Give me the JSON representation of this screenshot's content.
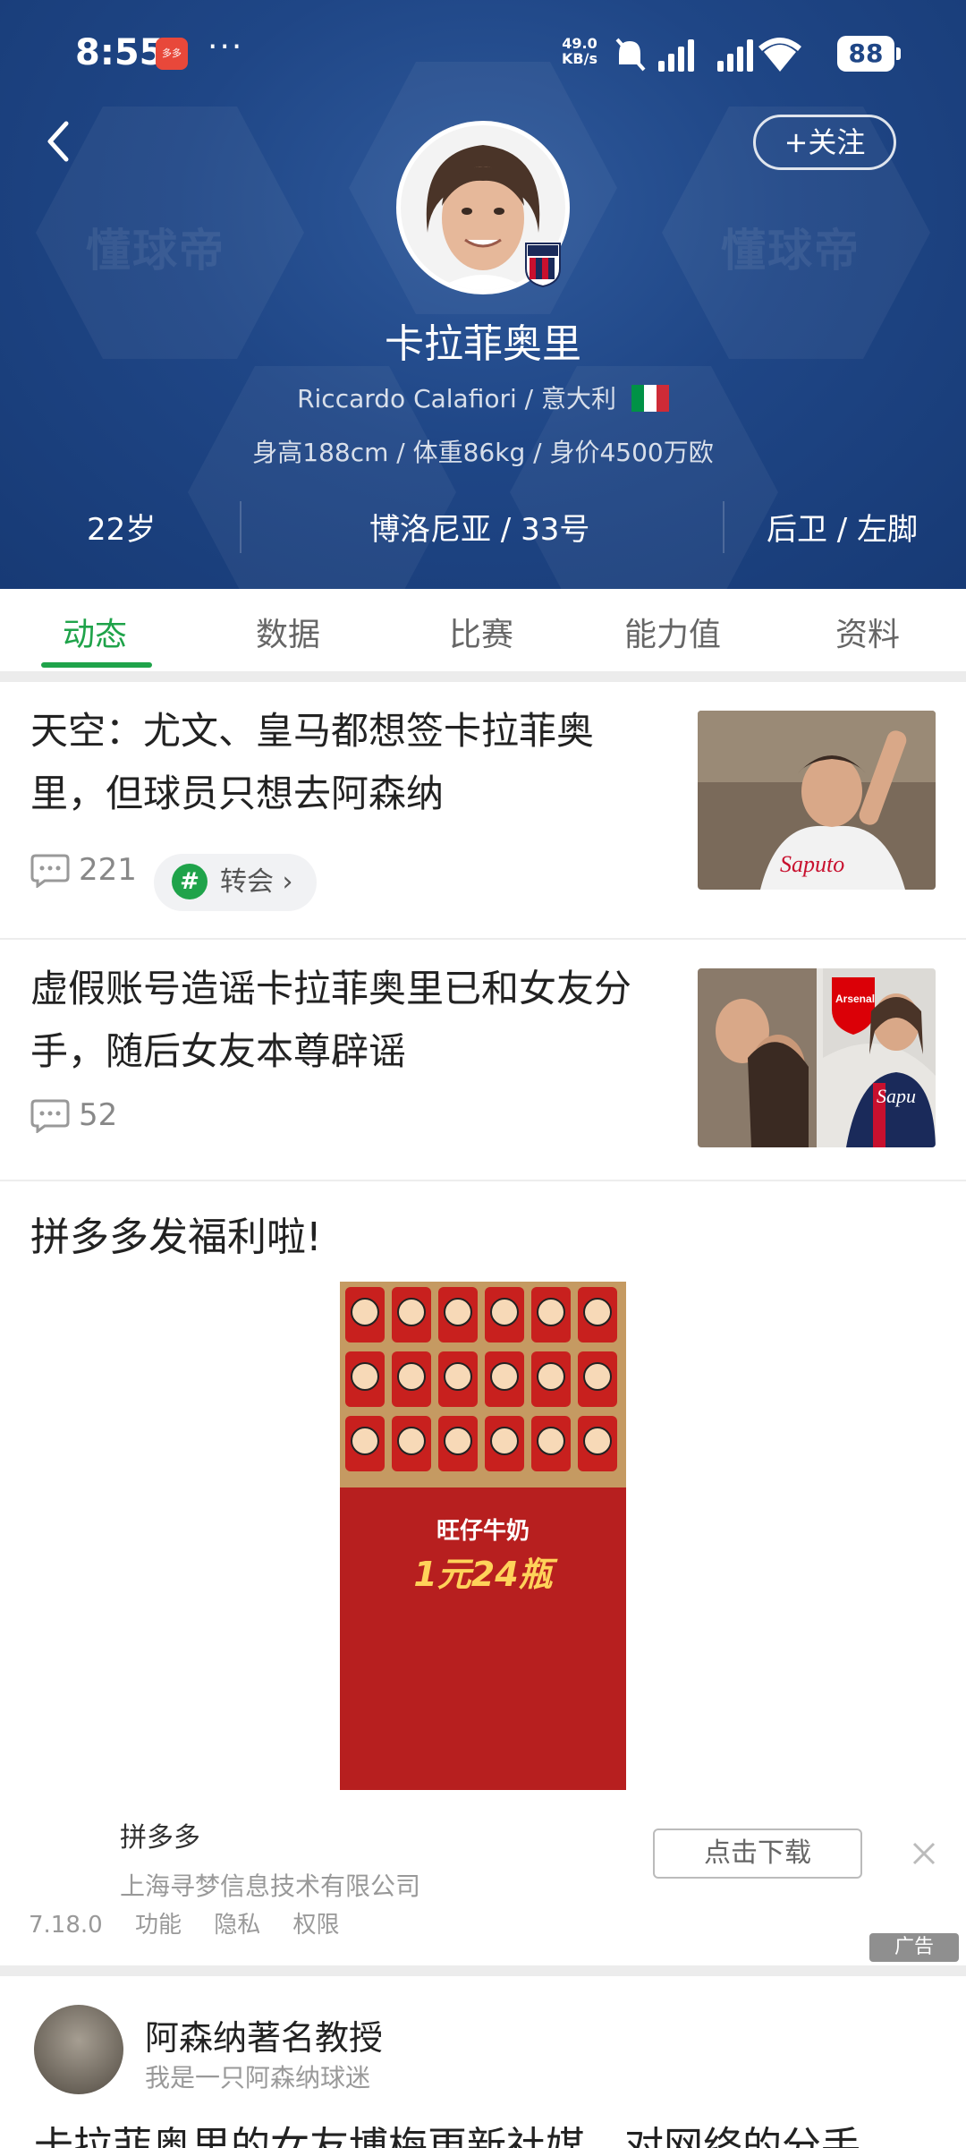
{
  "status_bar": {
    "time": "8:55",
    "app_badge": "多多",
    "overflow": "···",
    "net_speed_value": "49.0",
    "net_speed_unit": "KB/s",
    "battery": "88"
  },
  "header": {
    "follow_label": "+关注",
    "watermark": "懂球帝",
    "player_name_cn": "卡拉菲奥里",
    "player_name_en_nation": "Riccardo Calafiori / 意大利",
    "body_info": "身高188cm / 体重86kg / 身价4500万欧",
    "stats": [
      "22岁",
      "博洛尼亚 / 33号",
      "后卫 / 左脚"
    ],
    "icons": [
      "back-arrow-icon",
      "bologna-badge-icon",
      "italy-flag-icon"
    ]
  },
  "tabs": [
    {
      "label": "动态",
      "active": true
    },
    {
      "label": "数据",
      "active": false
    },
    {
      "label": "比赛",
      "active": false
    },
    {
      "label": "能力值",
      "active": false
    },
    {
      "label": "资料",
      "active": false
    }
  ],
  "news": [
    {
      "title": "天空：尤文、皇马都想签卡拉菲奥里，但球员只想去阿森纳",
      "comments": "221",
      "tag": "转会"
    },
    {
      "title": "虚假账号造谣卡拉菲奥里已和女友分手，随后女友本尊辟谣",
      "comments": "52"
    }
  ],
  "ad": {
    "title": "拼多多发福利啦!",
    "product": "旺仔牛奶",
    "price": "1元24瓶",
    "app_name": "拼多多",
    "company": "上海寻梦信息技术有限公司",
    "download_label": "点击下载",
    "version": "7.18.0",
    "links": [
      "功能",
      "隐私",
      "权限"
    ],
    "badge": "广告"
  },
  "post": {
    "user": "阿森纳著名教授",
    "bio": "我是一只阿森纳球迷",
    "text": "卡拉菲奥里的女友博梅更新社媒，对网络的分手"
  },
  "colors": {
    "header_blue": "#1f4686",
    "accent_green": "#1fa34a",
    "ad_red": "#b71f1f"
  }
}
